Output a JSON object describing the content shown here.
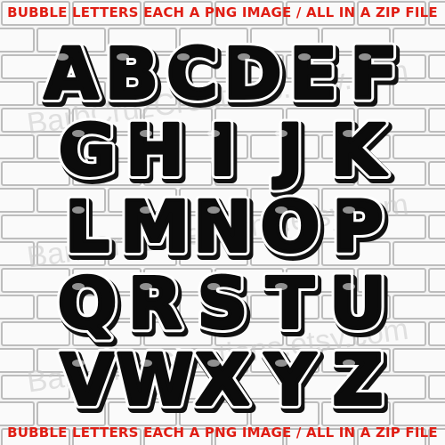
{
  "banner": {
    "top_text": "BUBBLE LETTERS EACH A PNG IMAGE / ALL IN A ZIP FILE",
    "bottom_text": "BUBBLE LETTERS EACH A PNG IMAGE / ALL IN A ZIP FILE",
    "text_color": "#e01e14"
  },
  "watermark": {
    "text": "BarbCruzCreations.etsy.com"
  },
  "alphabet": {
    "rows": [
      [
        "A",
        "B",
        "C",
        "D",
        "E",
        "F"
      ],
      [
        "G",
        "H",
        "I",
        "J",
        "K"
      ],
      [
        "L",
        "M",
        "N",
        "O",
        "P"
      ],
      [
        "Q",
        "R",
        "S",
        "T",
        "U"
      ],
      [
        "V",
        "W",
        "X",
        "Y",
        "Z"
      ]
    ]
  },
  "colors": {
    "letter_fill": "#0b0b0b",
    "letter_outline": "#ffffff",
    "shadow": "#111111",
    "brick_line": "#bdbdbd",
    "mortar": "#f4f4f4"
  }
}
